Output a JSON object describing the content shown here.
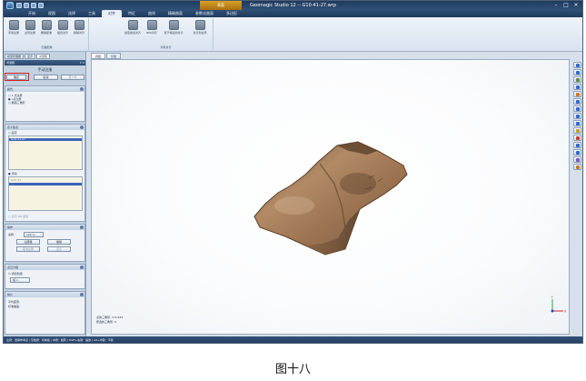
{
  "window": {
    "title": "Geomagic Studio 12 -- G10-41-27.wrp",
    "context_tab": "表面"
  },
  "ribbon": {
    "tabs": [
      "开始",
      "视图",
      "选择",
      "工具",
      "对齐",
      "特征",
      "曲线",
      "精确曲面",
      "参数化曲面",
      "多边形"
    ],
    "active_tab_index": 4,
    "groups": [
      {
        "label": "扫描配准",
        "buttons": [
          "手动注册",
          "全局注册",
          "删除配准",
          "组合对齐",
          "移除对齐"
        ]
      },
      {
        "label": "对象对齐",
        "buttons": [
          "最佳拟合对齐",
          "RPS对齐",
          "基于特征的对齐",
          "对齐到全局"
        ]
      }
    ]
  },
  "left_panel": {
    "tabs": [
      "模型管理器",
      "显示",
      "对话框"
    ],
    "dialog_header": "对话框",
    "dialog_title": "手动注册",
    "buttons": {
      "ok": "确定",
      "cancel": "取消",
      "next": "下一个"
    },
    "mode_section": {
      "title": "模式",
      "options": [
        "1 点注册",
        "n点注册",
        "删除三角形"
      ]
    },
    "define_section": {
      "title": "定义集合",
      "fixed_label": "固定",
      "fixed_items": [
        "G10-41-27",
        "..."
      ],
      "floating_label": "浮动",
      "floating_items": [
        "G10-41",
        "..."
      ],
      "footer": "□ 显示 HD 颜色"
    },
    "ops_section": {
      "title": "操作",
      "sampling": "采样：",
      "sampling_value": "100 %",
      "buttons": [
        "注册器",
        "撤销",
        "取消注册",
        "显示"
      ]
    },
    "display_section": {
      "title": "点云分组",
      "checkbox": "添加到组",
      "group_value": "组 1"
    },
    "stats_section": {
      "title": "统计",
      "lines": [
        "平均距离:",
        "标准偏差:"
      ]
    }
  },
  "view_tabs": [
    "视图",
    "比较"
  ],
  "viewport": {
    "stats": [
      "点的三角形: 174,932",
      "所选的三角形: 0"
    ],
    "axes": {
      "x": "X",
      "y": "Y"
    }
  },
  "right_tools": [
    "select-icon",
    "move-icon",
    "rotate-icon",
    "zoom-icon",
    "fit-icon",
    "iso-icon",
    "front-icon",
    "top-icon",
    "side-icon",
    "light-icon",
    "color-icon",
    "render-icon",
    "snap-icon",
    "shade-icon",
    "texture-icon"
  ],
  "statusbar": {
    "text": "左键：选择参考点 | 空格键：切换组 | 中键：旋转 | Shift+右键：缩放 | Alt+中键：平移"
  },
  "caption": "图十八",
  "colors": {
    "title_bar": "#2a4a72",
    "accent": "#d42222",
    "shard": "#a27a58"
  }
}
